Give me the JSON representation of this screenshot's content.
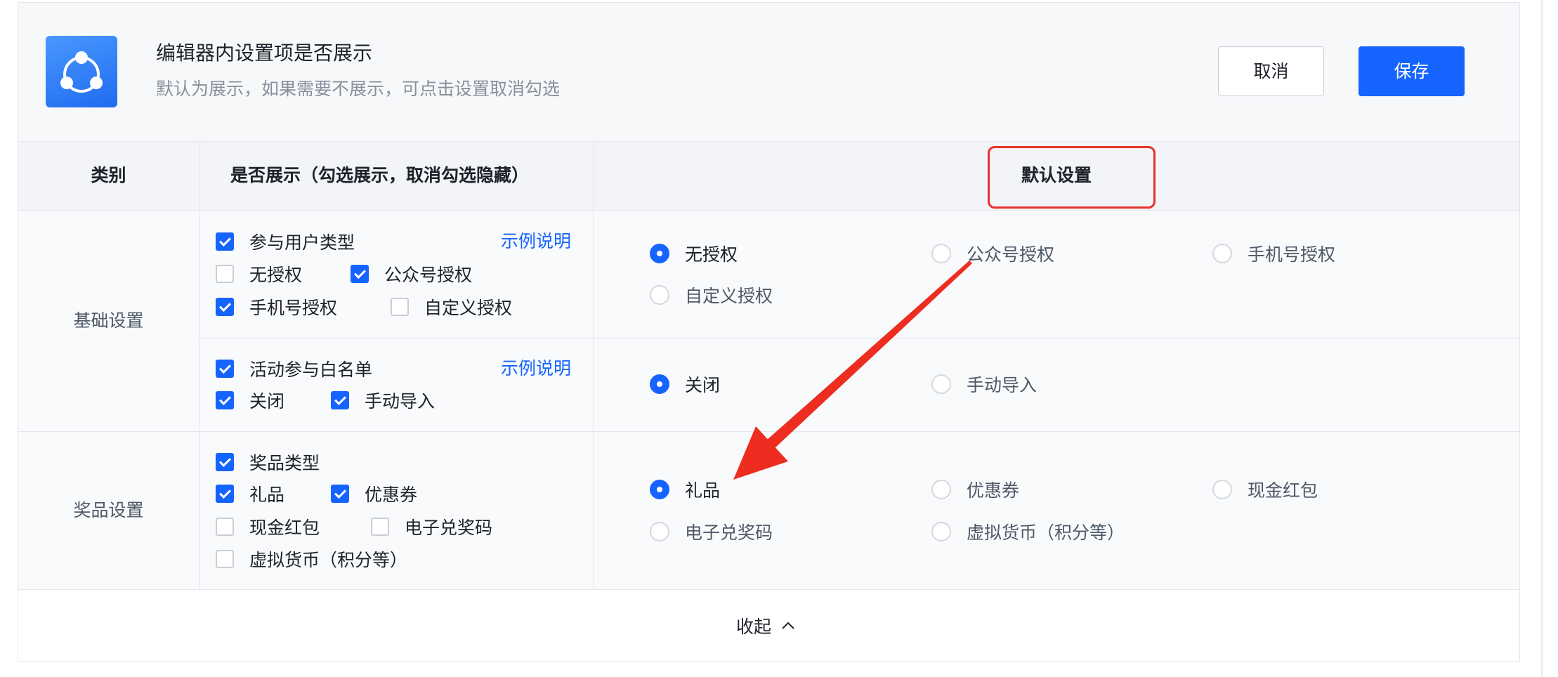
{
  "app": {
    "icon": "share-nodes-icon"
  },
  "header": {
    "title": "编辑器内设置项是否展示",
    "subtitle": "默认为展示，如果需要不展示，可点击设置取消勾选",
    "cancel_label": "取消",
    "save_label": "保存"
  },
  "table": {
    "columns": [
      "类别",
      "是否展示（勾选展示，取消勾选隐藏）",
      "默认设置"
    ],
    "groups": [
      {
        "category": "基础设置",
        "rows": [
          {
            "display": {
              "title": {
                "label": "参与用户类型",
                "checked": true
              },
              "help_link": "示例说明",
              "options": [
                {
                  "label": "无授权",
                  "checked": false
                },
                {
                  "label": "公众号授权",
                  "checked": true
                },
                {
                  "label": "手机号授权",
                  "checked": true
                },
                {
                  "label": "自定义授权",
                  "checked": false
                }
              ]
            },
            "defaults": [
              {
                "label": "无授权",
                "selected": true
              },
              {
                "label": "公众号授权",
                "selected": false
              },
              {
                "label": "手机号授权",
                "selected": false
              },
              {
                "label": "自定义授权",
                "selected": false
              }
            ]
          },
          {
            "display": {
              "title": {
                "label": "活动参与白名单",
                "checked": true
              },
              "help_link": "示例说明",
              "options": [
                {
                  "label": "关闭",
                  "checked": true
                },
                {
                  "label": "手动导入",
                  "checked": true
                }
              ]
            },
            "defaults": [
              {
                "label": "关闭",
                "selected": true
              },
              {
                "label": "手动导入",
                "selected": false
              }
            ]
          }
        ]
      },
      {
        "category": "奖品设置",
        "rows": [
          {
            "display": {
              "title": {
                "label": "奖品类型",
                "checked": true
              },
              "options": [
                {
                  "label": "礼品",
                  "checked": true
                },
                {
                  "label": "优惠券",
                  "checked": true
                },
                {
                  "label": "现金红包",
                  "checked": false
                },
                {
                  "label": "电子兑奖码",
                  "checked": false
                },
                {
                  "label": "虚拟货币（积分等）",
                  "checked": false
                }
              ]
            },
            "defaults": [
              {
                "label": "礼品",
                "selected": true
              },
              {
                "label": "优惠券",
                "selected": false
              },
              {
                "label": "现金红包",
                "selected": false
              },
              {
                "label": "电子兑奖码",
                "selected": false
              },
              {
                "label": "虚拟货币（积分等）",
                "selected": false
              }
            ]
          }
        ]
      }
    ]
  },
  "footer": {
    "collapse_label": "收起",
    "collapse_icon": "chevron-up-icon"
  },
  "theme": {
    "accent": "#1664ff",
    "annotation_red": "#ee2d21"
  }
}
